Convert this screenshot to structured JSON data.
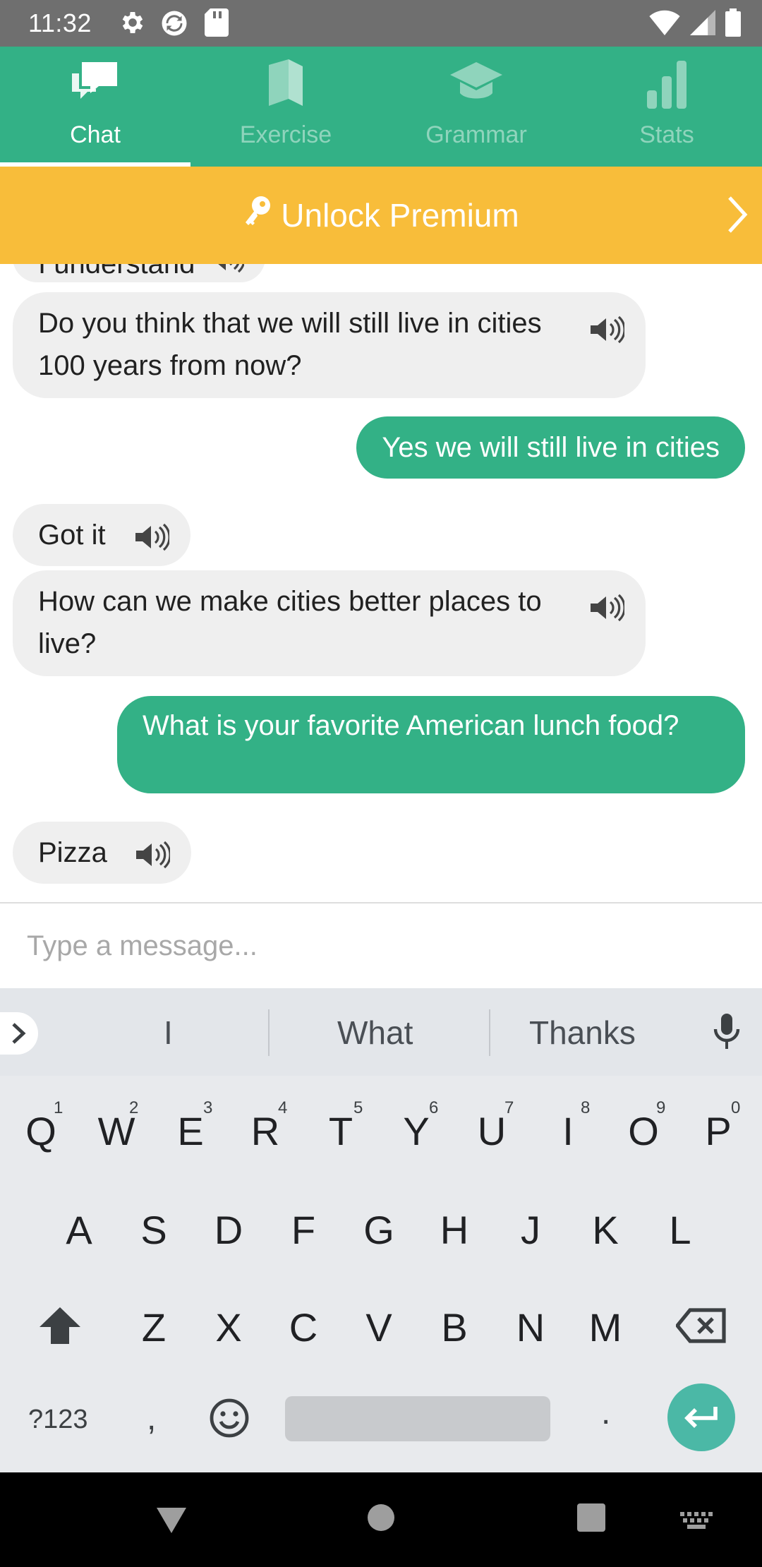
{
  "status": {
    "time": "11:32"
  },
  "tabs": [
    {
      "label": "Chat",
      "icon": "chat-bubbles-icon",
      "active": true
    },
    {
      "label": "Exercise",
      "icon": "book-icon",
      "active": false
    },
    {
      "label": "Grammar",
      "icon": "graduation-cap-icon",
      "active": false
    },
    {
      "label": "Stats",
      "icon": "bar-chart-icon",
      "active": false
    }
  ],
  "premium": {
    "label": "Unlock Premium",
    "icon": "key-icon"
  },
  "chat": {
    "partial_top": "I understand",
    "messages": [
      {
        "from": "bot",
        "text": "Do you think that we will still live in cities 100 years from now?"
      },
      {
        "from": "user",
        "text": "Yes we will still live in cities"
      },
      {
        "from": "bot",
        "text": "Got it"
      },
      {
        "from": "bot",
        "text": "How can we make cities better places to live?"
      },
      {
        "from": "user",
        "text": "What is your favorite American lunch food?"
      },
      {
        "from": "bot",
        "text": "Pizza"
      }
    ]
  },
  "input": {
    "placeholder": "Type a message..."
  },
  "keyboard": {
    "suggestions": [
      "I",
      "What",
      "Thanks"
    ],
    "row1": [
      "Q",
      "W",
      "E",
      "R",
      "T",
      "Y",
      "U",
      "I",
      "O",
      "P"
    ],
    "row1_hints": [
      "1",
      "2",
      "3",
      "4",
      "5",
      "6",
      "7",
      "8",
      "9",
      "0"
    ],
    "row2": [
      "A",
      "S",
      "D",
      "F",
      "G",
      "H",
      "J",
      "K",
      "L"
    ],
    "row3": [
      "Z",
      "X",
      "C",
      "V",
      "B",
      "N",
      "M"
    ],
    "symbols_label": "?123",
    "comma": ",",
    "period": "."
  },
  "colors": {
    "brand": "#33b186",
    "premium": "#f8bd3a",
    "bot_bubble": "#efefef",
    "enter": "#4bb8a6"
  }
}
